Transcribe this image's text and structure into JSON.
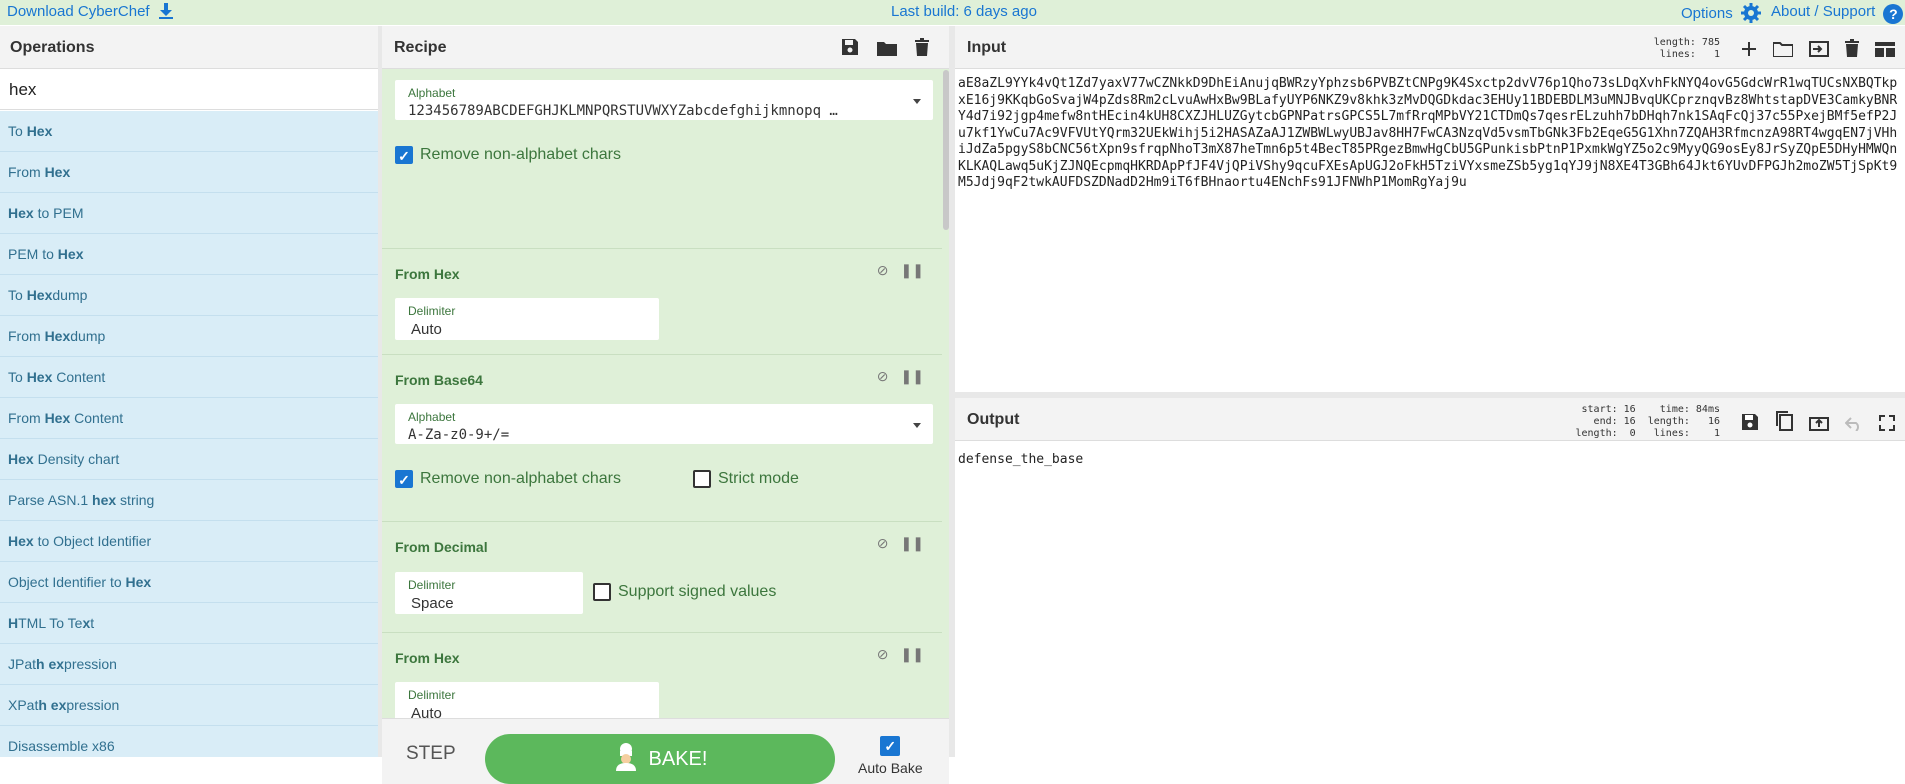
{
  "topbar": {
    "download_label": "Download CyberChef",
    "build_label": "Last build: 6 days ago",
    "options_label": "Options",
    "about_label": "About / Support"
  },
  "operations": {
    "title": "Operations",
    "search_value": "hex",
    "items": [
      {
        "pre": "To ",
        "match": "Hex",
        "post": ""
      },
      {
        "pre": "From ",
        "match": "Hex",
        "post": ""
      },
      {
        "pre": "",
        "match": "Hex",
        "post": " to PEM"
      },
      {
        "pre": "PEM to ",
        "match": "Hex",
        "post": ""
      },
      {
        "pre": "To ",
        "match": "Hex",
        "post": "dump"
      },
      {
        "pre": "From ",
        "match": "Hex",
        "post": "dump"
      },
      {
        "pre": "To ",
        "match": "Hex",
        "post": " Content"
      },
      {
        "pre": "From ",
        "match": "Hex",
        "post": " Content"
      },
      {
        "pre": "",
        "match": "Hex",
        "post": " Density chart"
      },
      {
        "pre": "Parse ASN.1 ",
        "match": "hex",
        "post": " string"
      },
      {
        "pre": "",
        "match": "Hex",
        "post": " to Object Identifier"
      },
      {
        "pre": "Object Identifier to ",
        "match": "Hex",
        "post": ""
      },
      {
        "pre": "",
        "match": "H",
        "post": "TML To Te",
        "match2": "x",
        "post2": "t"
      },
      {
        "pre": "JPat",
        "match": "h ex",
        "post": "pression"
      },
      {
        "pre": "XPat",
        "match": "h ex",
        "post": "pression"
      },
      {
        "pre": "Disassemble x86",
        "match": "",
        "post": ""
      }
    ]
  },
  "recipe": {
    "title": "Recipe",
    "op1": {
      "alphabet_label": "Alphabet",
      "alphabet_value": "123456789ABCDEFGHJKLMNPQRSTUVWXYZabcdefghijkmnopq …",
      "remove_label": "Remove non-alphabet chars"
    },
    "op2": {
      "title": "From Hex",
      "delimiter_label": "Delimiter",
      "delimiter_value": "Auto"
    },
    "op3": {
      "title": "From Base64",
      "alphabet_label": "Alphabet",
      "alphabet_value": "A-Za-z0-9+/=",
      "remove_label": "Remove non-alphabet chars",
      "strict_label": "Strict mode"
    },
    "op4": {
      "title": "From Decimal",
      "delimiter_label": "Delimiter",
      "delimiter_value": "Space",
      "signed_label": "Support signed values"
    },
    "op5": {
      "title": "From Hex",
      "delimiter_label": "Delimiter",
      "delimiter_value": "Auto"
    },
    "step_label": "STEP",
    "bake_label": "BAKE!",
    "autobake_label": "Auto Bake"
  },
  "input": {
    "title": "Input",
    "stats": "length: 785\n lines:   1",
    "text": "aE8aZL9YYk4vQt1Zd7yaxV77wCZNkkD9DhEiAnujqBWRzyYphzsb6PVBZtCNPg9K4Sxctp2dvV76p1Qho73sLDqXvhFkNYQ4ovG5GdcWrR1wqTUCsNXBQTkpxE16j9KKqbGoSvajW4pZds8Rm2cLvuAwHxBw9BLafyUYP6NKZ9v8khk3zMvDQGDkdac3EHUy11BDEBDLM3uMNJBvqUKCprznqvBz8WhtstapDVE3CamkyBNRY4d7i92jgp4mefw8ntHEcin4kUH8CXZJHLUZGytcbGPNPatrsGPCS5L7mfRrqMPbVY21CTDmQs7qesrELzuhh7bDHqh7nk1SAqFcQj37c55PxejBMf5efP2Ju7kf1YwCu7Ac9VFVUtYQrm32UEkWihj5i2HASAZaAJ1ZWBWLwyUBJav8HH7FwCA3NzqVd5vsmTbGNk3Fb2EqeG5G1Xhn7ZQAH3RfmcnzA98RT4wgqEN7jVHhiJdZa5pgyS8bCNC56tXpn9sfrqpNhoT3mX87heTmn6p5t4BecT85PRgezBmwHgCbU5GPunkisbPtnP1PxmkWgYZ5o2c9MyyQG9osEy8JrSyZQpE5DHyHMWQnKLKAQLawq5uKjZJNQEcpmqHKRDApPfJF4VjQPiVShy9qcuFXEsApUGJ2oFkH5TziVYxsmeZSb5yg1qYJ9jN8XE4T3GBh64Jkt6YUvDFPGJh2moZW5TjSpKt9M5Jdj9qF2twkAUFDSZDNadD2Hm9iT6fBHnaortu4ENchFs91JFNWhP1MomRgYaj9u"
  },
  "output": {
    "title": "Output",
    "stats": "start: 16    time: 84ms\n  end: 16  length:   16\nlength:  0   lines:    1",
    "text": "defense_the_base"
  },
  "colors": {
    "accent": "#1976d2",
    "recipe_bg": "#dff0d8",
    "op_bg": "#d9edf7",
    "bake": "#5cb85c"
  }
}
